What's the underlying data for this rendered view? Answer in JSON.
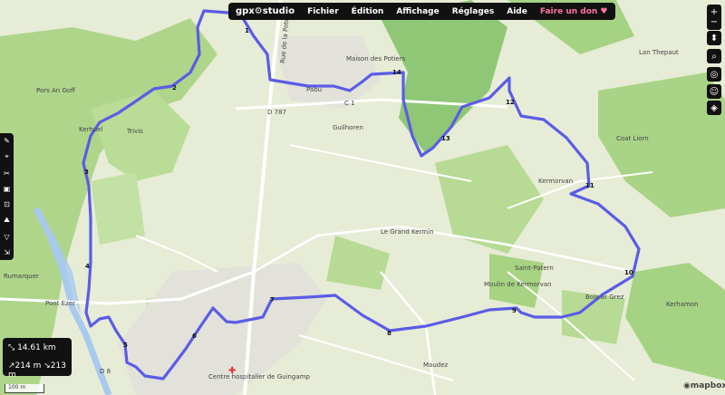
{
  "menubar": {
    "logo_left": "gpx",
    "logo_right": "studio",
    "items": [
      "Fichier",
      "Édition",
      "Affichage",
      "Réglages",
      "Aide"
    ],
    "donate": "Faire un don ♥"
  },
  "right_tools": [
    "zoom-in",
    "zoom-out",
    "compass",
    "search",
    "locate",
    "street-view",
    "layers"
  ],
  "left_tools": [
    "edit",
    "poi",
    "cut",
    "image",
    "crop",
    "route",
    "filter",
    "extract"
  ],
  "stats": {
    "distance": "14.61 km",
    "elevation_up": "214 m",
    "elevation_down": "213 m"
  },
  "scale": "100 m",
  "attribution": "mapbox",
  "place_labels": [
    "Pors An Goff",
    "Kerhuel",
    "Trivis",
    "Rumarquer",
    "Pont Ezer",
    "Pabu",
    "Guilhoren",
    "Maison des Potiers",
    "Lan Thepaut",
    "Coat Liorn",
    "Kermorvan",
    "Le Grand Kermin",
    "Saint-Patern",
    "Moulin de Kermorvan",
    "Bois ar Grez",
    "Kerhamon",
    "Maudez",
    "Centre hospitalier de Guingamp",
    "Rue de la Poterie",
    "D 787",
    "C 1",
    "D 8"
  ],
  "waypoints": [
    "1",
    "2",
    "3",
    "4",
    "5",
    "6",
    "7",
    "8",
    "9",
    "10",
    "11",
    "12",
    "13",
    "14"
  ],
  "colors": {
    "track": "#5b5ce6",
    "water": "#a9c9ee",
    "forest": "#a9d386",
    "road": "#ffffff"
  }
}
